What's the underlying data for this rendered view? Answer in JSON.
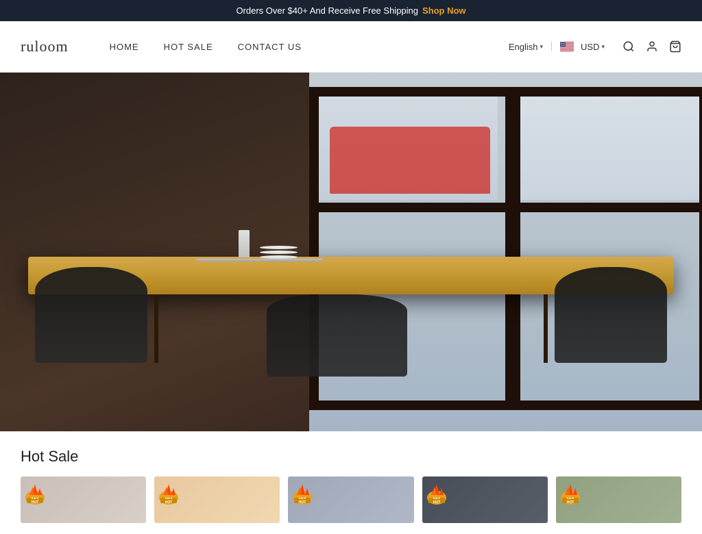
{
  "announcement": {
    "text": "Orders Over $40+ And Receive Free Shipping",
    "link_text": "Shop Now",
    "link_url": "#"
  },
  "header": {
    "logo": "ruloom",
    "nav": [
      {
        "label": "HOME",
        "url": "#"
      },
      {
        "label": "HOT SALE",
        "url": "#"
      },
      {
        "label": "CONTACT US",
        "url": "#"
      }
    ],
    "language": {
      "label": "English",
      "chevron": "▾"
    },
    "currency": {
      "label": "USD",
      "chevron": "▾"
    }
  },
  "hero": {
    "alt": "Restaurant dining area with wooden table and black chairs"
  },
  "hot_sale": {
    "title": "Hot Sale",
    "products": [
      {
        "id": 1,
        "badge": "HOT SALE",
        "alt": "Product 1"
      },
      {
        "id": 2,
        "badge": "HOT SALE",
        "alt": "Product 2"
      },
      {
        "id": 3,
        "badge": "HOT SALE",
        "alt": "Product 3"
      },
      {
        "id": 4,
        "badge": "HOT SALE",
        "alt": "Product 4"
      },
      {
        "id": 5,
        "badge": "HOT SALE",
        "alt": "Product 5"
      }
    ]
  },
  "icons": {
    "search": "🔍",
    "account": "👤",
    "cart": "🛒"
  }
}
